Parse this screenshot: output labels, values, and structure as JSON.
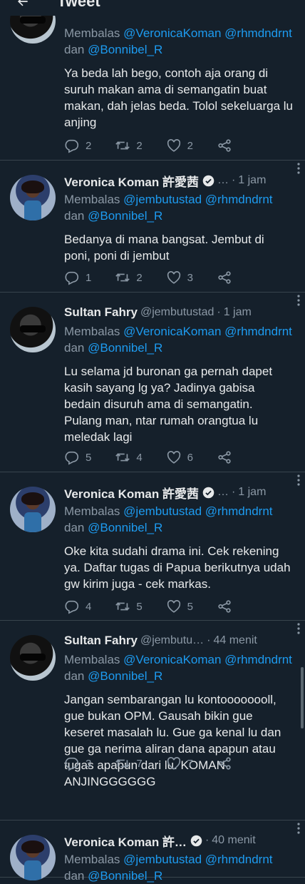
{
  "header": {
    "title": "Tweet"
  },
  "labels": {
    "replying": "Membalas",
    "and": "dan"
  },
  "tweets": [
    {
      "author": "",
      "handle": "",
      "time": "",
      "verified": false,
      "avatar": "sultan",
      "replying": [
        "@VeronicaKoman",
        "@rhmdndrnt",
        "@Bonnibel_R"
      ],
      "text": "Ya beda lah bego, contoh aja orang di suruh makan ama di semangatin buat makan, dah jelas beda. Tolol sekeluarga lu anjing",
      "replies": "2",
      "retweets": "2",
      "likes": "2"
    },
    {
      "author": "Veronica Koman 許愛茜",
      "handle": "…",
      "time": "1 jam",
      "verified": true,
      "avatar": "veronica",
      "replying": [
        "@jembutustad",
        "@rhmdndrnt",
        "@Bonnibel_R"
      ],
      "text": "Bedanya di mana bangsat. Jembut di poni, poni di jembut",
      "replies": "1",
      "retweets": "2",
      "likes": "3"
    },
    {
      "author": "Sultan Fahry",
      "handle": "@jembutustad",
      "time": "1 jam",
      "verified": false,
      "avatar": "sultan",
      "replying": [
        "@VeronicaKoman",
        "@rhmdndrnt",
        "@Bonnibel_R"
      ],
      "text": "Lu selama jd buronan ga pernah dapet kasih sayang lg ya? Jadinya gabisa bedain disuruh ama di semangatin. Pulang man, ntar rumah orangtua lu meledak lagi",
      "replies": "5",
      "retweets": "4",
      "likes": "6"
    },
    {
      "author": "Veronica Koman 許愛茜",
      "handle": "…",
      "time": "1 jam",
      "verified": true,
      "avatar": "veronica",
      "replying": [
        "@jembutustad",
        "@rhmdndrnt",
        "@Bonnibel_R"
      ],
      "text": "Oke kita sudahi drama ini. Cek rekening ya. Daftar tugas di Papua berikutnya udah gw kirim juga - cek markas.",
      "replies": "4",
      "retweets": "5",
      "likes": "5"
    },
    {
      "author": "Sultan Fahry",
      "handle": "@jembutu…",
      "time": "44 menit",
      "verified": false,
      "avatar": "sultan",
      "replying": [
        "@VeronicaKoman",
        "@rhmdndrnt",
        "@Bonnibel_R"
      ],
      "text": "Jangan sembarangan lu kontoooooooll, gue bukan OPM. Gausah bikin gue keseret masalah lu. Gue ga kenal lu dan gue ga nerima aliran dana apapun atau tugas apapun dari lu. KOMAN ANJINGGGGGG",
      "replies": "3",
      "retweets": "7",
      "likes": "7"
    },
    {
      "author": "Veronica Koman 許…",
      "handle": "",
      "time": "40 menit",
      "verified": true,
      "avatar": "veronica",
      "replying": [
        "@jembutustad",
        "@rhmdndrnt",
        "@Bonnibel_R"
      ],
      "text": "",
      "replies": "",
      "retweets": "",
      "likes": ""
    }
  ]
}
